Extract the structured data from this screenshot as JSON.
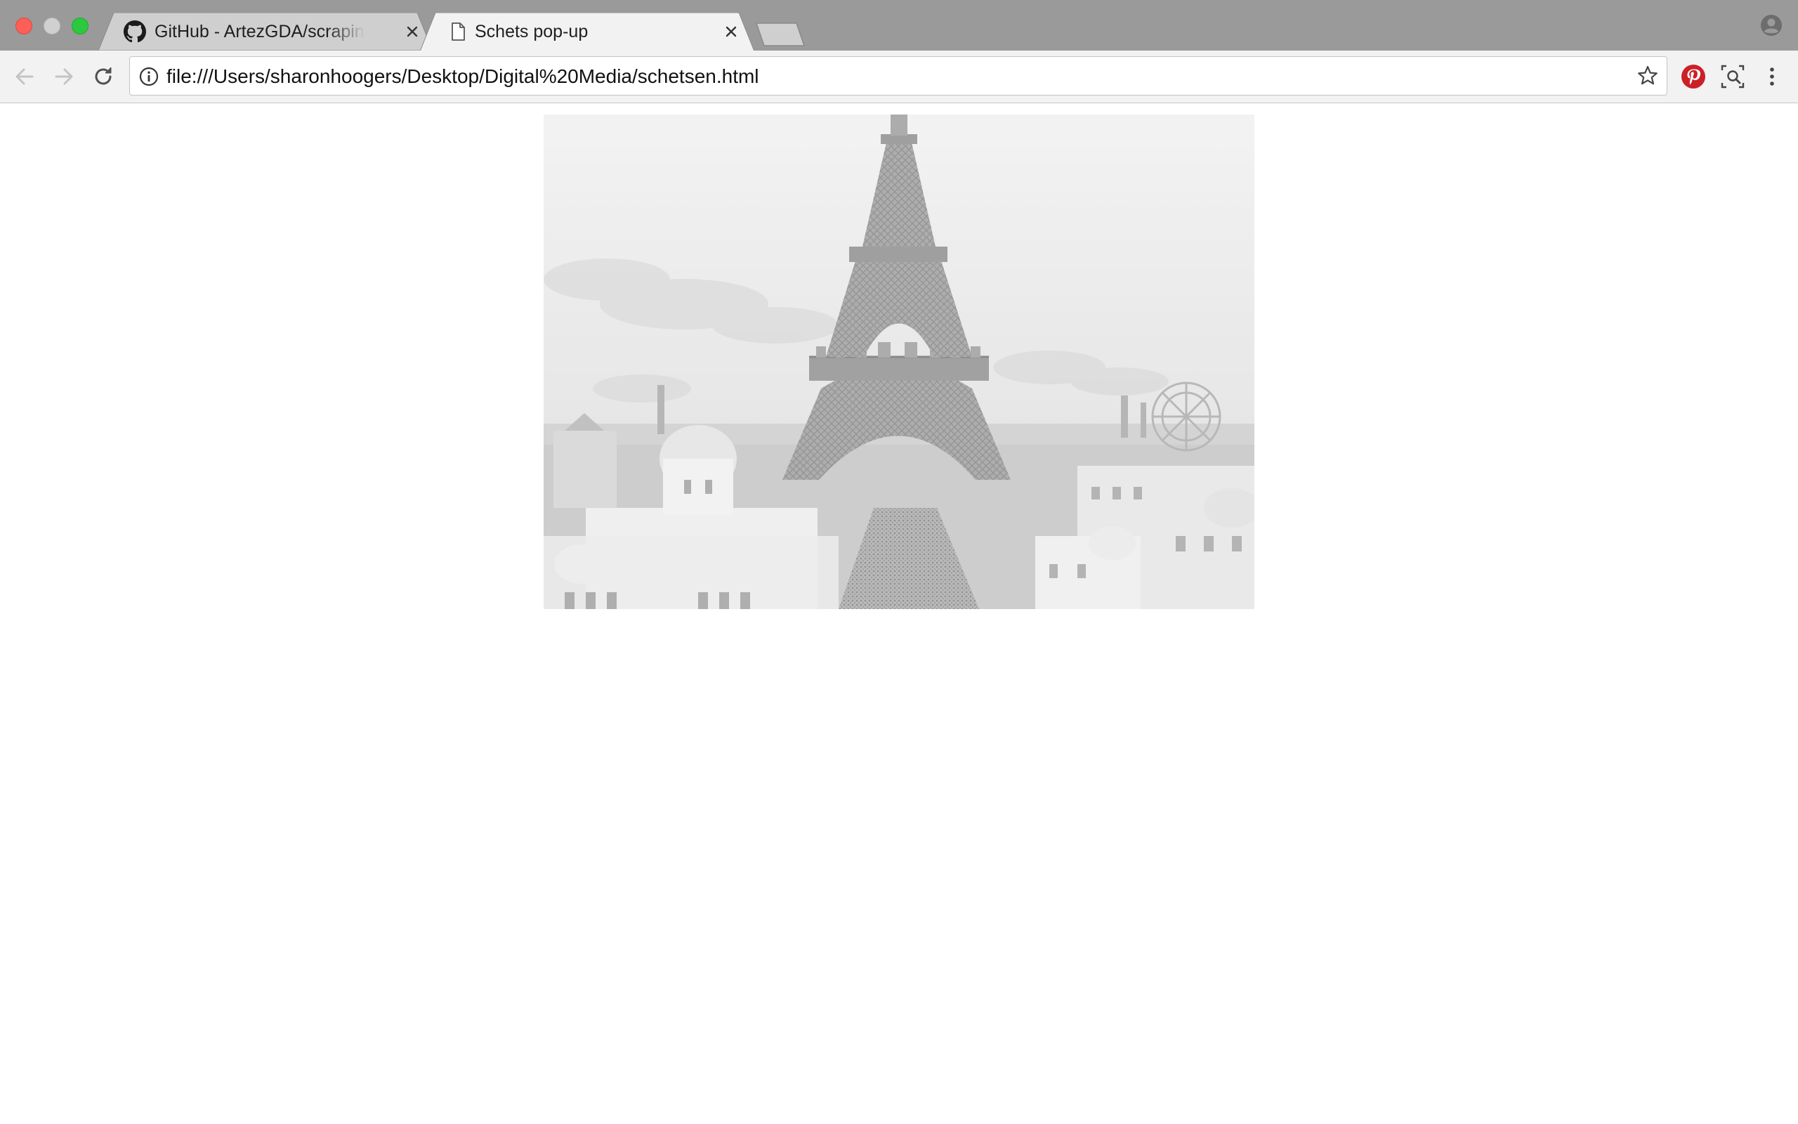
{
  "window": {
    "controls": [
      "close",
      "minimize",
      "maximize"
    ]
  },
  "tabs": [
    {
      "title": "GitHub - ArtezGDA/scrapingTo",
      "favicon": "github-icon",
      "active": false
    },
    {
      "title": "Schets pop-up",
      "favicon": "page-icon",
      "active": true
    }
  ],
  "toolbar": {
    "url": "file:///Users/sharonhoogers/Desktop/Digital%20Media/schetsen.html",
    "back_enabled": false,
    "forward_enabled": false
  },
  "extensions": [
    "pinterest-icon",
    "screen-capture-icon"
  ],
  "content": {
    "image_description_icon": "eiffel-tower-photo",
    "image_style": "faded grayscale"
  },
  "colors": {
    "tabstrip_bg": "#9a9a9a",
    "active_tab_bg": "#f2f2f2",
    "inactive_tab_bg": "#cfcfcf",
    "toolbar_bg": "#f2f2f2",
    "pinterest_red": "#cb2027",
    "close_red": "#fc5f57",
    "maximize_green": "#2bc840"
  }
}
